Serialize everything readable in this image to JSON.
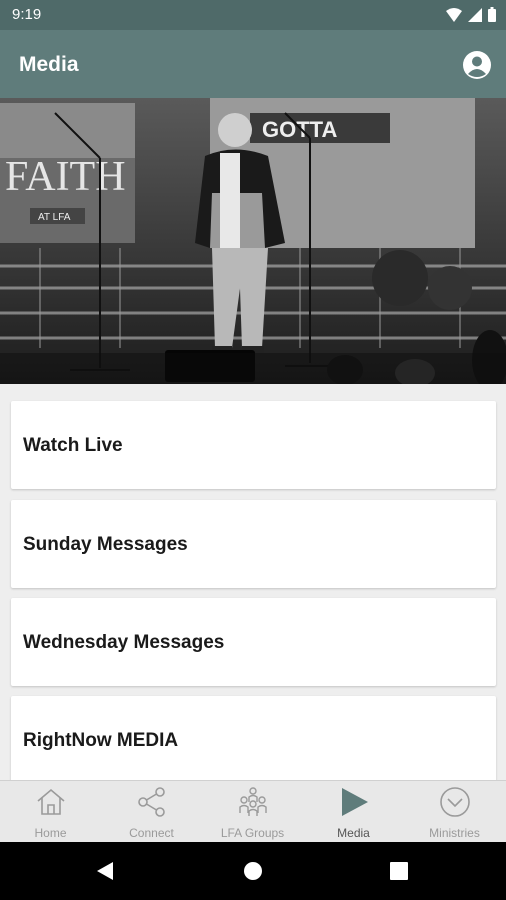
{
  "status_bar": {
    "time": "9:19"
  },
  "header": {
    "title": "Media"
  },
  "hero": {
    "banner_text_1": "GOTTA",
    "banner_text_2": "FAITH",
    "banner_text_3": "AT LFA"
  },
  "menu": [
    {
      "label": "Watch Live"
    },
    {
      "label": "Sunday Messages"
    },
    {
      "label": "Wednesday Messages"
    },
    {
      "label": "RightNow MEDIA"
    }
  ],
  "tabs": [
    {
      "label": "Home",
      "icon": "home-icon"
    },
    {
      "label": "Connect",
      "icon": "share-icon"
    },
    {
      "label": "LFA Groups",
      "icon": "group-icon"
    },
    {
      "label": "Media",
      "icon": "play-icon",
      "active": true
    },
    {
      "label": "Ministries",
      "icon": "chevron-circle-icon"
    }
  ],
  "colors": {
    "app_bar": "#5f7c7b",
    "status_bar": "#4f6a69",
    "active_tab": "#5f7c7b"
  }
}
